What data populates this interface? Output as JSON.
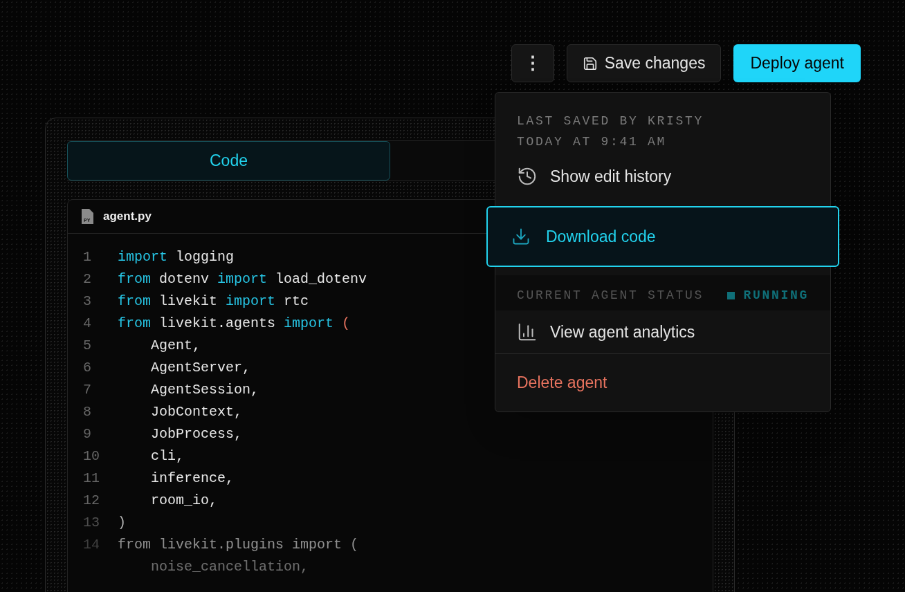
{
  "toolbar": {
    "more_label": "⋮",
    "save": "Save changes",
    "deploy": "Deploy agent"
  },
  "tabs": [
    {
      "label": "Code",
      "selected": true
    }
  ],
  "file": {
    "name": "agent.py",
    "badge": "PY"
  },
  "code": [
    {
      "number": "1",
      "tokens": [
        {
          "kind": "keyword",
          "text": "import"
        },
        {
          "kind": "plain",
          "text": " logging"
        }
      ]
    },
    {
      "number": "2",
      "tokens": [
        {
          "kind": "keyword",
          "text": "from"
        },
        {
          "kind": "plain",
          "text": " dotenv "
        },
        {
          "kind": "keyword",
          "text": "import"
        },
        {
          "kind": "plain",
          "text": " load_dotenv"
        }
      ]
    },
    {
      "number": "3",
      "tokens": [
        {
          "kind": "keyword",
          "text": "from"
        },
        {
          "kind": "plain",
          "text": " livekit "
        },
        {
          "kind": "keyword",
          "text": "import"
        },
        {
          "kind": "plain",
          "text": " rtc"
        }
      ]
    },
    {
      "number": "4",
      "tokens": [
        {
          "kind": "keyword",
          "text": "from"
        },
        {
          "kind": "plain",
          "text": " livekit.agents "
        },
        {
          "kind": "keyword",
          "text": "import"
        },
        {
          "kind": "paren",
          "text": " ("
        }
      ]
    },
    {
      "number": "5",
      "tokens": [
        {
          "kind": "plain",
          "text": "    Agent,"
        }
      ]
    },
    {
      "number": "6",
      "tokens": [
        {
          "kind": "plain",
          "text": "    AgentServer,"
        }
      ]
    },
    {
      "number": "7",
      "tokens": [
        {
          "kind": "plain",
          "text": "    AgentSession,"
        }
      ]
    },
    {
      "number": "8",
      "tokens": [
        {
          "kind": "plain",
          "text": "    JobContext,"
        }
      ]
    },
    {
      "number": "9",
      "tokens": [
        {
          "kind": "plain",
          "text": "    JobProcess,"
        }
      ]
    },
    {
      "number": "10",
      "tokens": [
        {
          "kind": "plain",
          "text": "    cli,"
        }
      ]
    },
    {
      "number": "11",
      "tokens": [
        {
          "kind": "plain",
          "text": "    inference,"
        }
      ]
    },
    {
      "number": "12",
      "tokens": [
        {
          "kind": "plain",
          "text": "    room_io,"
        }
      ]
    },
    {
      "number": "13",
      "tokens": [
        {
          "kind": "plain",
          "text": ")"
        }
      ]
    },
    {
      "number": "14",
      "tokens": [
        {
          "kind": "plain",
          "text": "from livekit.plugins import ("
        }
      ]
    },
    {
      "tokens": [
        {
          "kind": "plain",
          "text": "    noise_cancellation,"
        }
      ]
    }
  ],
  "menu": [
    {
      "kind": "caption",
      "lines": [
        "LAST SAVED BY KRISTY",
        "TODAY AT 9:41 AM"
      ]
    },
    {
      "kind": "action",
      "label": "Show edit history",
      "selected": false
    },
    {
      "kind": "action",
      "label": "Download code",
      "selected": true
    },
    {
      "kind": "status",
      "label": "CURRENT AGENT STATUS",
      "value": "RUNNING",
      "color": "#0f6f78"
    },
    {
      "kind": "action",
      "label": "View agent analytics",
      "selected": false
    },
    {
      "kind": "danger",
      "label": "Delete agent"
    }
  ]
}
